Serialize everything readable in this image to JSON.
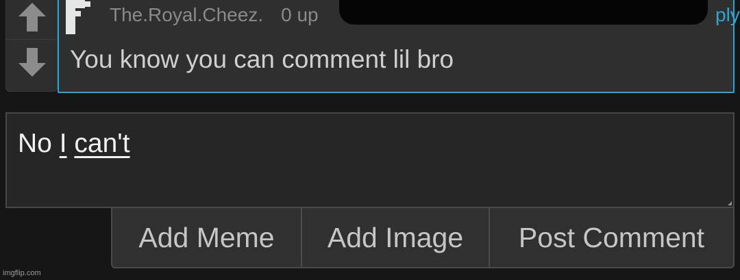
{
  "comment": {
    "username": "The.Royal.Cheez.",
    "points": "0 up",
    "reply_label": "ply",
    "body": "You know you can comment lil bro"
  },
  "reply_box": {
    "word1": "No",
    "word2": "I",
    "word3": "can't"
  },
  "buttons": {
    "add_meme": "Add Meme",
    "add_image": "Add Image",
    "post_comment": "Post Comment"
  },
  "watermark": "imgflip.com",
  "colors": {
    "accent": "#2aa8d4",
    "background": "#161616",
    "panel": "#2f2f2f"
  },
  "icons": {
    "upvote": "arrow-up-icon",
    "downvote": "arrow-down-icon"
  }
}
